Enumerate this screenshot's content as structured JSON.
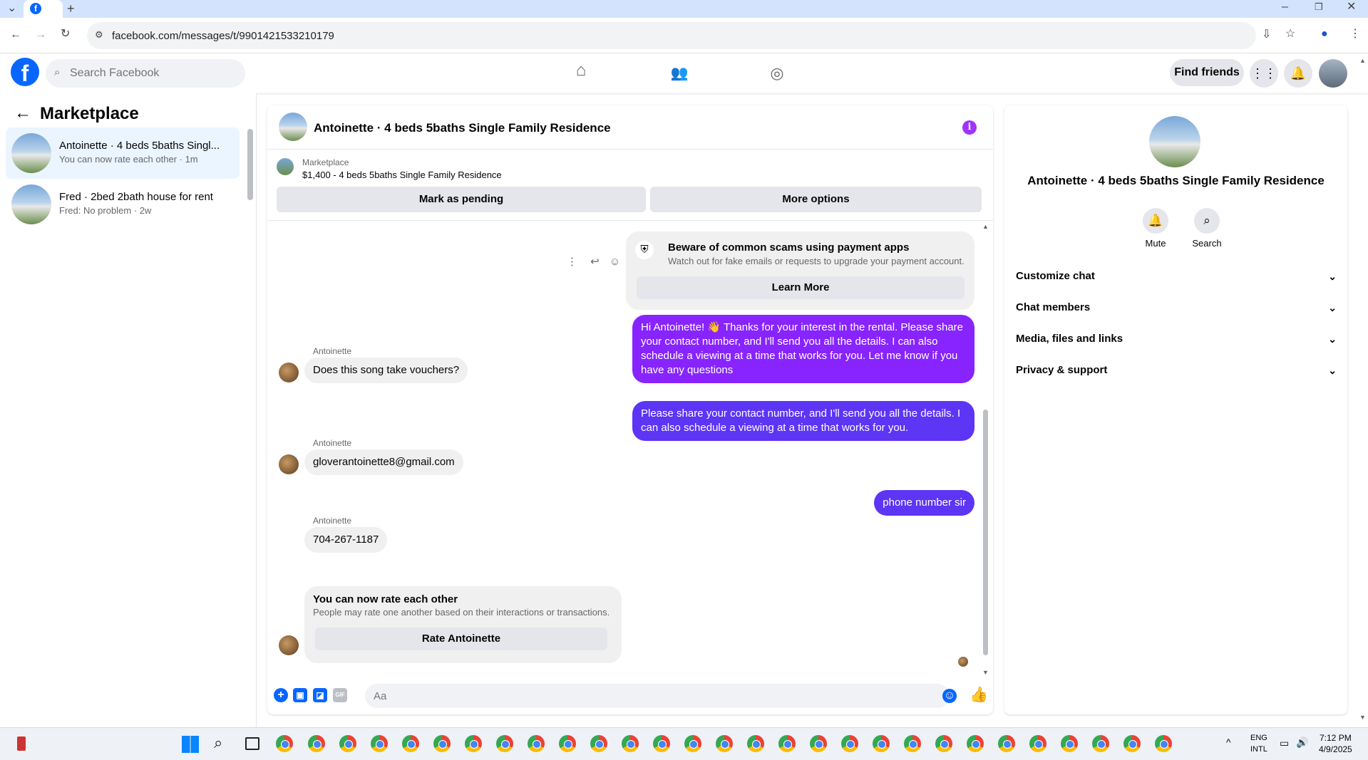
{
  "browser": {
    "url": "facebook.com/messages/t/9901421533210179"
  },
  "fb": {
    "search_placeholder": "Search Facebook",
    "find_friends": "Find friends"
  },
  "left": {
    "title": "Marketplace",
    "conversations": [
      {
        "name": "Antoinette · 4 beds 5baths Singl...",
        "sub": "You can now rate each other · 1m"
      },
      {
        "name": "Fred · 2bed 2bath house for rent",
        "sub": "Fred: No problem · 2w"
      }
    ]
  },
  "chat": {
    "title": "Antoinette · 4 beds 5baths Single Family Residence",
    "marketplace_label": "Marketplace",
    "listing": "$1,400 - 4 beds 5baths Single Family Residence",
    "mark_pending": "Mark as pending",
    "more_options": "More options",
    "scam": {
      "title": "Beware of common scams using payment apps",
      "sub": "Watch out for fake emails or requests to upgrade your payment account.",
      "button": "Learn More"
    },
    "messages": {
      "out1": "Hi Antoinette! 👋 Thanks for your interest in the rental. Please share your contact number, and I'll send you all the details. I can also schedule a viewing at a time that works for you. Let me know if you have any questions",
      "sender": "Antoinette",
      "in1": "Does this song take vouchers?",
      "out2": "Please share your contact number, and I'll send you all the details. I can also schedule a viewing at a time that works for you.",
      "in2": "gloverantoinette8@gmail.com",
      "out3": "phone number sir",
      "in3": "704-267-1187"
    },
    "rate": {
      "title": "You can now rate each other",
      "sub": "People may rate one another based on their interactions or transactions.",
      "button": "Rate Antoinette"
    },
    "composer_placeholder": "Aa"
  },
  "right": {
    "title": "Antoinette · 4 beds 5baths Single Family Residence",
    "mute": "Mute",
    "search": "Search",
    "rows": [
      "Customize chat",
      "Chat members",
      "Media, files and links",
      "Privacy & support"
    ]
  },
  "taskbar": {
    "lang1": "ENG",
    "lang2": "INTL",
    "time": "7:12 PM",
    "date": "4/9/2025"
  },
  "colors": {
    "accent": "#0866ff",
    "bubble_out": "#8724ff",
    "bubble_out_blue": "#5c35f5"
  },
  "icons": [
    "home-icon",
    "friends-icon",
    "groups-icon",
    "grid-menu-icon",
    "bell-icon",
    "info-icon",
    "shield-icon",
    "plus-icon",
    "photo-icon",
    "sticker-icon",
    "gif-icon",
    "emoji-icon",
    "like-icon",
    "search-icon"
  ]
}
